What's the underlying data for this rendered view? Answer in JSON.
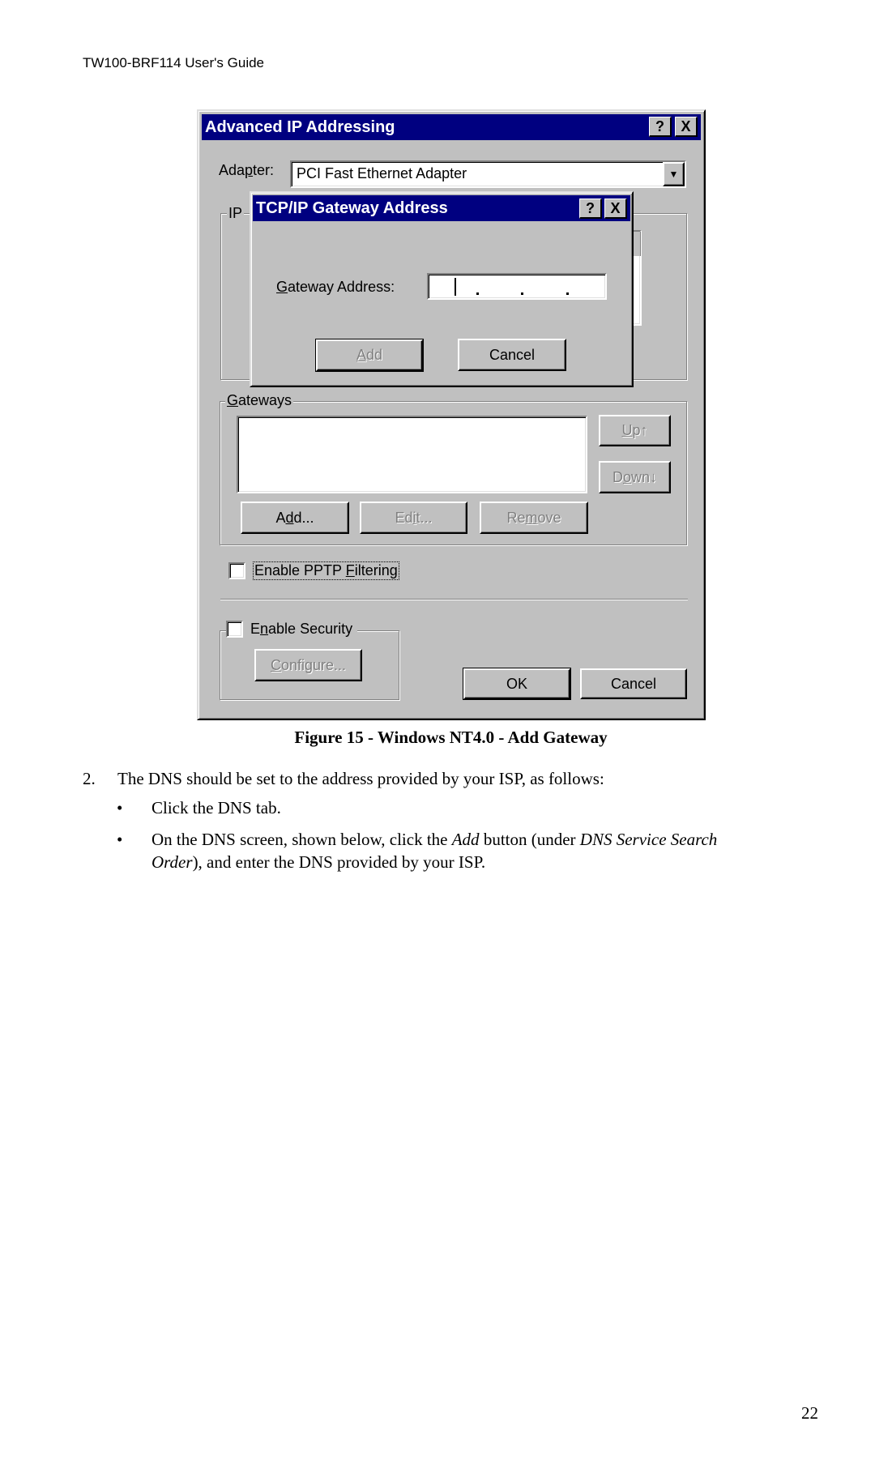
{
  "page": {
    "header": "TW100-BRF114 User's Guide",
    "page_number": "22"
  },
  "dialog": {
    "title": "Advanced IP Addressing",
    "help_button": "?",
    "close_button": "X",
    "adapter_label_pre": "Ada",
    "adapter_label_ul": "p",
    "adapter_label_post": "ter:",
    "adapter_value": "PCI Fast Ethernet Adapter",
    "ip_group_label": "IP",
    "gateways_group": {
      "label_ul": "G",
      "label_post": "ateways",
      "items": [],
      "up_pre": "",
      "up_ul": "U",
      "up_post": "p↑",
      "down_pre": "D",
      "down_ul": "o",
      "down_post": "wn↓",
      "add_pre": "A",
      "add_ul": "d",
      "add_post": "d...",
      "edit_pre": "Ed",
      "edit_ul": "i",
      "edit_post": "t...",
      "remove_pre": "Re",
      "remove_ul": "m",
      "remove_post": "ove"
    },
    "pptp": {
      "label_pre": "Enable PPTP ",
      "label_ul": "F",
      "label_post": "iltering",
      "checked": false
    },
    "security": {
      "label_pre": "E",
      "label_ul": "n",
      "label_post": "able Security",
      "checked": false,
      "configure_ul": "C",
      "configure_post": "onfigure..."
    },
    "ok_button": "OK",
    "cancel_button": "Cancel"
  },
  "subdialog": {
    "title": "TCP/IP Gateway Address",
    "help_button": "?",
    "close_button": "X",
    "gateway_label_ul": "G",
    "gateway_label_post": "ateway Address:",
    "gateway_value": "",
    "add_ul": "A",
    "add_post": "dd",
    "cancel_button": "Cancel"
  },
  "document": {
    "caption": "Figure 15 - Windows NT4.0 - Add Gateway",
    "step_number": "2.",
    "step_text": "The DNS should be set to the address provided by your ISP, as follows:",
    "bullets": [
      {
        "text": "Click the DNS tab."
      },
      {
        "part1": "On the DNS screen, shown below, click the ",
        "italic1": "Add",
        "part2": " button (under ",
        "italic2": "DNS Service Search",
        "italic3": "Order",
        "part3": "), and enter the DNS provided by your ISP."
      }
    ],
    "bullet_glyph": "•"
  }
}
